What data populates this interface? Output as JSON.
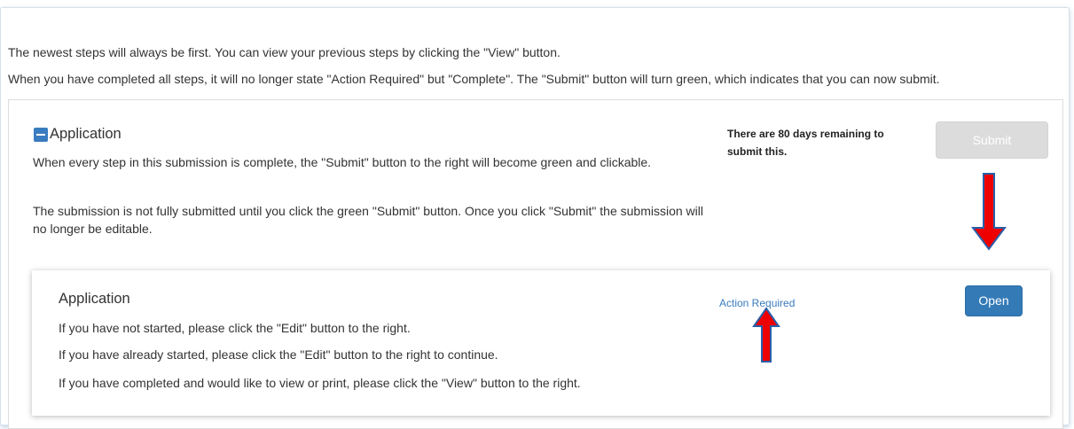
{
  "intro": {
    "line1": "The newest steps will always be first. You can view your previous steps by clicking the \"View\" button.",
    "line2": "When you have completed all steps, it will no longer state \"Action Required\" but \"Complete\". The \"Submit\" button will turn green, which indicates that you can now submit."
  },
  "submission": {
    "title": "Application",
    "collapse_icon": "minus-square-icon",
    "paragraph1": "When every step in this submission is complete, the \"Submit\" button to the right will become green and clickable.",
    "paragraph2": "The submission is not fully submitted until you click the green \"Submit\" button. Once you click \"Submit\" the submission will no longer be editable.",
    "days_remaining": "There are 80 days remaining to submit this.",
    "submit_label": "Submit",
    "submit_state": "disabled"
  },
  "step": {
    "title": "Application",
    "line1": "If you have not started, please click the \"Edit\" button to the right.",
    "line2": "If you have already started, please click the \"Edit\" button to the right to continue.",
    "line3": "If you have completed and would like to view or print, please click the \"View\" button to the right.",
    "status": "Action Required",
    "open_label": "Open"
  },
  "annotations": {
    "arrow_icon": "red-arrow-icon",
    "arrow_color": "#ee0000"
  },
  "colors": {
    "primary_button": "#337ab7",
    "disabled_button": "#dcdcdc",
    "link": "#3a7cc0"
  }
}
